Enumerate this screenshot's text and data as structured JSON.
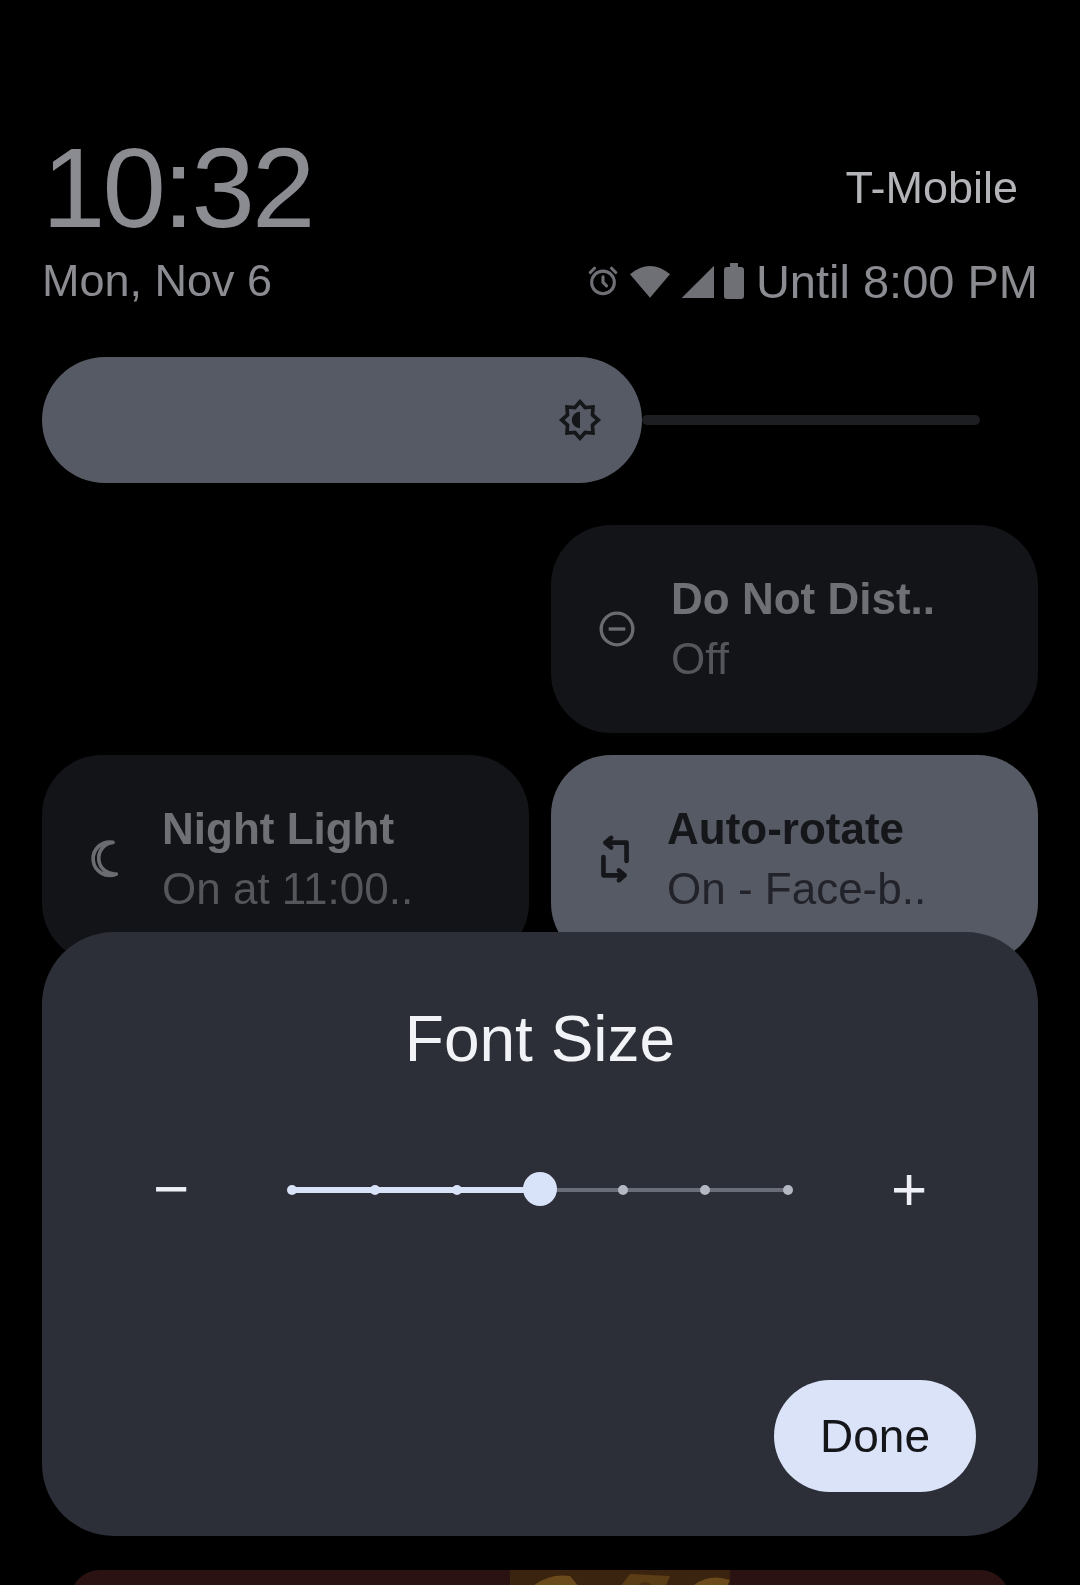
{
  "header": {
    "time": "10:32",
    "date": "Mon, Nov 6",
    "carrier": "T-Mobile",
    "battery_text": "Until 8:00 PM"
  },
  "brightness": {
    "level": 0.64
  },
  "tiles": [
    {
      "kind": "dnd",
      "title": "Do Not Dist..",
      "subtitle": "Off",
      "on": false
    },
    {
      "kind": "night",
      "title": "Night Light",
      "subtitle": "On at 11:00..",
      "on": false
    },
    {
      "kind": "rotate",
      "title": "Auto-rotate",
      "subtitle": "On - Face-b..",
      "on": true
    }
  ],
  "dialog": {
    "title": "Font Size",
    "minus": "−",
    "plus": "+",
    "level": 0.5,
    "button": "Done"
  }
}
